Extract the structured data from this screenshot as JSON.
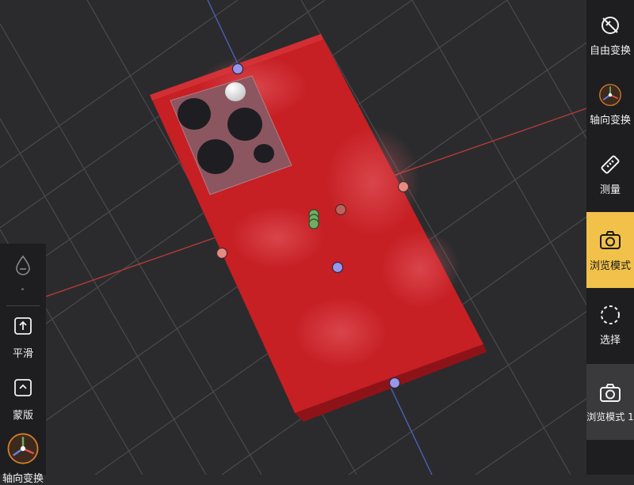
{
  "colors": {
    "background": "#2b2b2d",
    "grid": "#4a4a4d",
    "axis_red": "#b23a3a",
    "axis_blue": "#4c5fb8",
    "phone_body": "#c61f24",
    "phone_side": "#8e1318",
    "handle_blue": "#9a97ea",
    "handle_red": "#e78a84",
    "handle_green": "#6fae62",
    "toolbar_bg": "#1e1e20",
    "active_tool": "#f2c14a"
  },
  "right_toolbar": {
    "tools": [
      {
        "label": "自由变换",
        "icon": "free-transform-icon"
      },
      {
        "label": "轴向变换",
        "icon": "axis-gizmo-icon"
      },
      {
        "label": "测量",
        "icon": "ruler-icon"
      },
      {
        "label": "浏览模式",
        "icon": "camera-icon",
        "active": true
      },
      {
        "label": "选择",
        "icon": "dashed-circle-icon"
      },
      {
        "label": "浏览模式 1",
        "icon": "camera-icon"
      }
    ]
  },
  "left_toolbar": {
    "tools": [
      {
        "label": "",
        "icon": "drop-icon"
      },
      {
        "label": "平滑",
        "icon": "upload-square-icon"
      },
      {
        "label": "蒙版",
        "icon": "caret-square-icon"
      },
      {
        "label": "轴向变换",
        "icon": "axis-gizmo-icon"
      }
    ]
  }
}
